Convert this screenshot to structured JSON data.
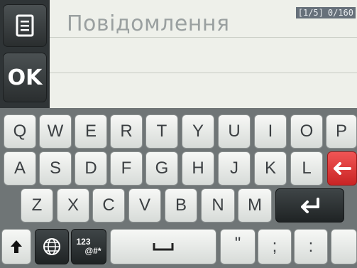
{
  "message": {
    "placeholder": "Повідомлення",
    "page_counter": "[1/5]",
    "char_counter": "0/160"
  },
  "side": {
    "ok_label": "OK"
  },
  "keyboard": {
    "row1": [
      "Q",
      "W",
      "E",
      "R",
      "T",
      "Y",
      "U",
      "I",
      "O",
      "P"
    ],
    "row2": [
      "A",
      "S",
      "D",
      "F",
      "G",
      "H",
      "J",
      "K",
      "L"
    ],
    "row3": [
      "Z",
      "X",
      "C",
      "V",
      "B",
      "N",
      "M"
    ],
    "symbols_top": "123",
    "symbols_bottom": "@#*",
    "key_quote": "\"",
    "key_semicolon": ";",
    "key_colon": ":",
    "key_delete_accent": "#d93333"
  }
}
